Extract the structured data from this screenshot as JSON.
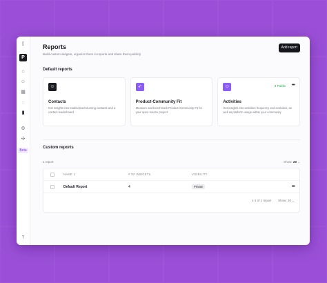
{
  "page": {
    "title": "Reports",
    "subtitle": "Build custom widgets, organize them in reports and share them publicly",
    "add_button": "Add report"
  },
  "rail": {
    "logo_letter": "P",
    "beta": "Beta"
  },
  "default_reports": {
    "heading": "Default reports",
    "cards": [
      {
        "icon": "contacts-icon",
        "color": "#1b1b22",
        "name": "Contacts",
        "desc": "Get insights into total/active/returning contacts and a contact leaderboard"
      },
      {
        "icon": "rocket-icon",
        "color": "#8b5cf6",
        "name": "Product-Community Fit",
        "desc": "Measure and benchmark Product-Community Fit for your open-source project"
      },
      {
        "icon": "activities-icon",
        "color": "#8b5cf6",
        "name": "Activities",
        "desc": "Get insights into activities frequency and evolution, as well as platform usage within your community",
        "public_label": "Public"
      }
    ]
  },
  "custom_reports": {
    "heading": "Custom reports",
    "count_text": "1 report",
    "show_label": "Show:",
    "show_value": "20",
    "columns": [
      "NAME",
      "# OF WIDGETS",
      "VISIBILITY"
    ],
    "rows": [
      {
        "name": "Default Report",
        "widgets": "4",
        "visibility": "Private"
      }
    ],
    "pagination": "1-1 of 1 report"
  },
  "colors": {
    "accent": "#8b5cf6",
    "public": "#16a34a",
    "dark": "#15151c"
  }
}
